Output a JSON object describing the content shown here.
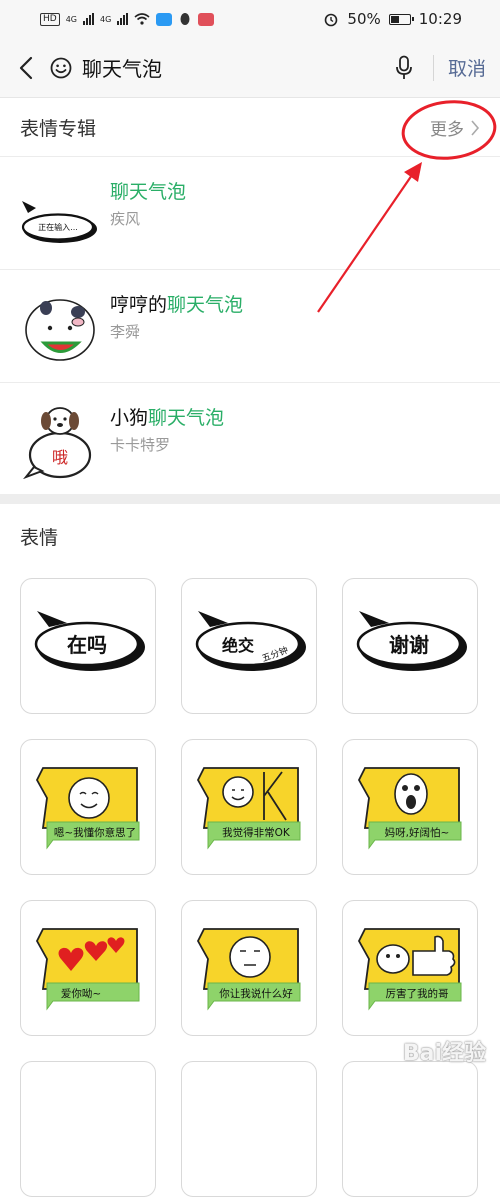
{
  "status": {
    "left": {
      "hd": "HD",
      "net1": "4G",
      "net2": "4G"
    },
    "battery_percent": 50,
    "battery_label": "50%",
    "time": "10:29"
  },
  "search": {
    "query": "聊天气泡",
    "cancel_label": "取消"
  },
  "albums_section": {
    "title": "表情专辑",
    "more_label": "更多",
    "items": [
      {
        "prefix": "",
        "highlight": "聊天气泡",
        "author": "疾风",
        "thumb_text": "正在输入..."
      },
      {
        "prefix": "哼哼的",
        "highlight": "聊天气泡",
        "author": "李舜",
        "thumb_text": ""
      },
      {
        "prefix": "小狗",
        "highlight": "聊天气泡",
        "author": "卡卡特罗",
        "thumb_text": "哦"
      }
    ]
  },
  "stickers_section": {
    "title": "表情",
    "items": [
      {
        "text": "在吗",
        "sub": ""
      },
      {
        "text": "绝交",
        "sub": "五分钟"
      },
      {
        "text": "谢谢",
        "sub": ""
      },
      {
        "text": "嗯~我懂你意思了",
        "sub": ""
      },
      {
        "text": "我觉得非常OK",
        "sub": "OK"
      },
      {
        "text": "妈呀,好阔怕~",
        "sub": ""
      },
      {
        "text": "爱你呦~",
        "sub": ""
      },
      {
        "text": "你让我说什么好",
        "sub": ""
      },
      {
        "text": "厉害了我的哥",
        "sub": ""
      }
    ]
  },
  "colors": {
    "highlight": "#2aae67",
    "cancel": "#576b95",
    "annotation": "#e8202a",
    "sticker_yellow": "#f7d42a",
    "sticker_green": "#8ed36a"
  },
  "watermark": "Bai经验"
}
